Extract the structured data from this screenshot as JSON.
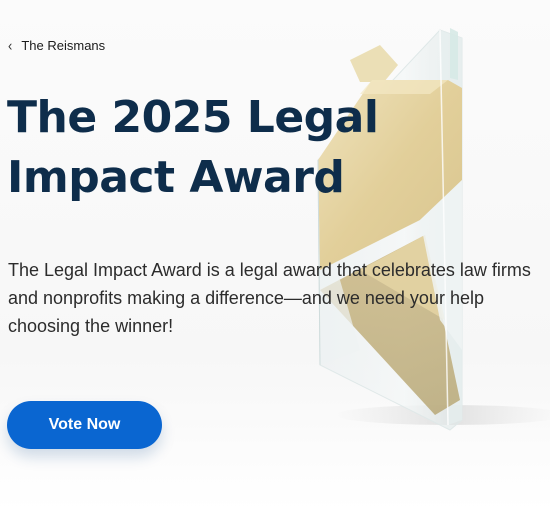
{
  "breadcrumb": {
    "icon": "chevron-left-icon",
    "label": "The Reismans"
  },
  "hero": {
    "title": "The 2025 Legal Impact Award",
    "description": "The Legal Impact Award is a legal award that celebrates law firms and nonprofits making a difference—and we need your help choosing the winner!",
    "cta_label": "Vote Now"
  },
  "colors": {
    "title": "#0e2d4b",
    "body_text": "#2c2c2c",
    "cta_background": "#0a66d1",
    "cta_text": "#ffffff",
    "page_background": "#fafafa",
    "trophy_gold": "#e2cf9a"
  }
}
